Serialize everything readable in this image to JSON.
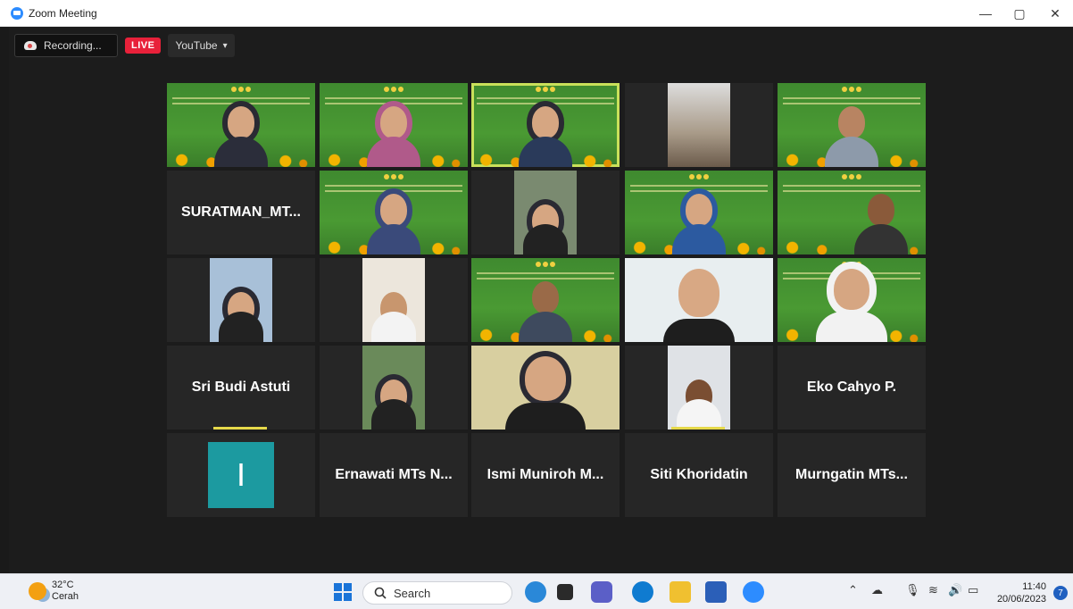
{
  "window": {
    "title": "Zoom Meeting",
    "minimize": "—",
    "maximize": "▢",
    "close": "✕"
  },
  "toolbar": {
    "recording_label": "Recording...",
    "live_label": "LIVE",
    "stream_label": "YouTube",
    "stream_caret": "▾"
  },
  "participants_named": {
    "suratman": "SURATMAN_MT...",
    "sri_budi": "Sri Budi Astuti",
    "eko": "Eko Cahyo P.",
    "ernawati": "Ernawati MTs N...",
    "ismi": "Ismi Muniroh M...",
    "siti": "Siti Khoridatin",
    "murngatin": "Murngatin MTs...",
    "avatar_letter": "I"
  },
  "colors": {
    "active_speaker": "#c9e05a",
    "live": "#e8213a",
    "avatar": "#1c9aa0"
  },
  "taskbar": {
    "temp": "32°C",
    "weather": "Cerah",
    "search_placeholder": "Search",
    "time": "11:40",
    "date": "20/06/2023",
    "notification_count": "7"
  }
}
